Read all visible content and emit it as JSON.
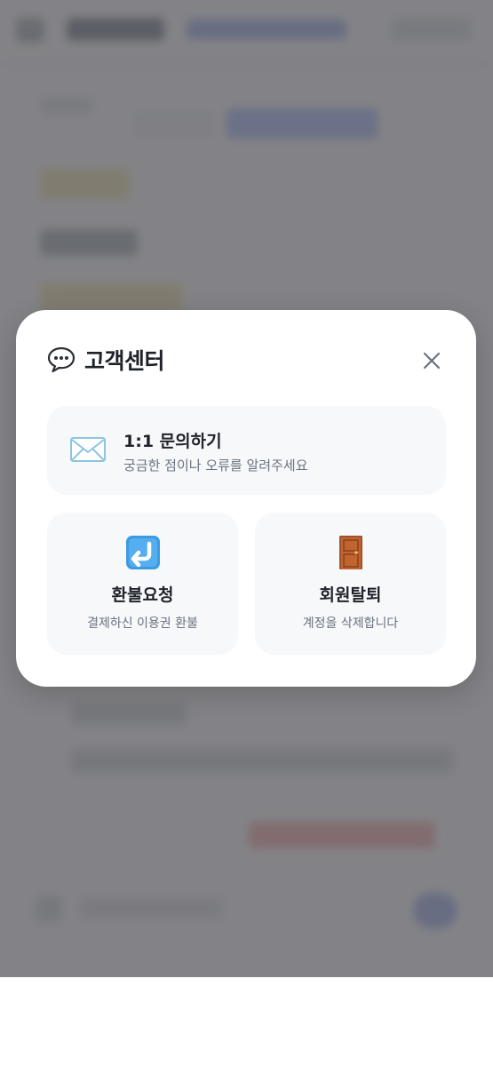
{
  "modal": {
    "title": "고객센터",
    "title_icon": "speech-balloon-icon",
    "close_icon": "close-icon",
    "inquiry": {
      "icon": "envelope-icon",
      "title": "1:1 문의하기",
      "description": "궁금한 점이나 오류를 알려주세요"
    },
    "refund": {
      "icon": "return-arrow-icon",
      "title": "환불요청",
      "description": "결제하신 이용권 환불"
    },
    "withdraw": {
      "icon": "door-icon",
      "title": "회원탈퇴",
      "description": "계정을 삭제합니다"
    }
  },
  "colors": {
    "overlay": "#58585c",
    "modal_bg": "#ffffff",
    "card_bg": "#f6f8fa",
    "title_text": "#1f2329",
    "desc_text": "#6b7280"
  }
}
